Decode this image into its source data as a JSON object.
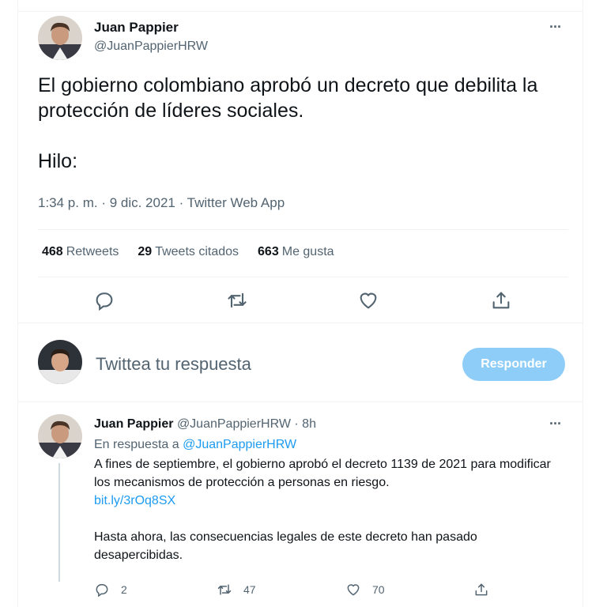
{
  "main_tweet": {
    "author_name": "Juan Pappier",
    "author_handle": "@JuanPappierHRW",
    "text_line1": "El gobierno colombiano aprobó un decreto que debilita la protección de líderes sociales.",
    "text_line2": "Hilo:",
    "timestamp": "1:34 p. m. · 9 dic. 2021 · Twitter Web App",
    "stats": {
      "retweets_count": "468",
      "retweets_label": "Retweets",
      "quotes_count": "29",
      "quotes_label": "Tweets citados",
      "likes_count": "663",
      "likes_label": "Me gusta"
    },
    "more_label": "···"
  },
  "composer": {
    "placeholder": "Twittea tu respuesta",
    "button_label": "Responder"
  },
  "reply_tweet": {
    "author_name": "Juan Pappier",
    "author_handle": "@JuanPappierHRW · 8h",
    "replying_prefix": "En respuesta a",
    "replying_handle": "@JuanPappierHRW",
    "para1": "A fines de septiembre, el gobierno aprobó el decreto 1139 de 2021 para modificar los mecanismos de protección a personas en riesgo.",
    "link": "bit.ly/3rOq8SX",
    "para2": "Hasta ahora, las consecuencias legales de este decreto han pasado desapercibidas.",
    "reply_count": "2",
    "retweet_count": "47",
    "like_count": "70",
    "more_label": "···"
  },
  "icons": {
    "reply": "reply-icon",
    "retweet": "retweet-icon",
    "like": "heart-icon",
    "share": "share-icon",
    "more": "more-icon"
  },
  "colors": {
    "accent": "#1d9bf0",
    "button_disabled": "#8ecdf8",
    "secondary_text": "#536471",
    "border": "#eff3f4"
  }
}
